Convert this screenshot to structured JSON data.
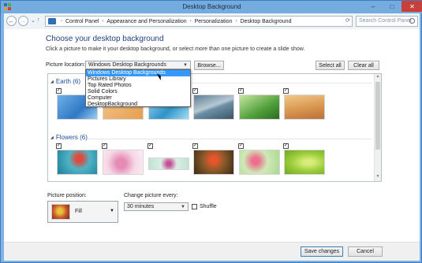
{
  "window": {
    "title": "Desktop Background",
    "controls": {
      "minimize": "–",
      "maximize": "□",
      "close": "✕"
    }
  },
  "nav": {
    "back": "←",
    "forward": "→",
    "recent": "⌄",
    "up": "↑",
    "breadcrumb": [
      "Control Panel",
      "Appearance and Personalization",
      "Personalization",
      "Desktop Background"
    ],
    "separator": "›",
    "refresh": "⟳",
    "search_placeholder": "Search Control Panel"
  },
  "main": {
    "heading": "Choose your desktop background",
    "subheading": "Click a picture to make it your desktop background, or select more than one picture to create a slide show.",
    "picture_location_label": "Picture location:",
    "picture_location_value": "Windows Desktop Backgrounds",
    "browse_label": "Browse...",
    "select_all_label": "Select all",
    "clear_all_label": "Clear all",
    "location_options": [
      "Windows Desktop Backgrounds",
      "Pictures Library",
      "Top Rated Photos",
      "Solid Colors",
      "Computer",
      "DesktopBackground"
    ],
    "groups": [
      {
        "name": "Earth (6)",
        "checked_count": 6
      },
      {
        "name": "Flowers (6)",
        "checked_count": 6
      }
    ],
    "check_mark": "✓",
    "picture_position_label": "Picture position:",
    "picture_position_value": "Fill",
    "change_every_label": "Change picture every:",
    "change_every_value": "30 minutes",
    "shuffle_label": "Shuffle",
    "shuffle_checked": false
  },
  "footer": {
    "save_label": "Save changes",
    "cancel_label": "Cancel"
  },
  "colors": {
    "accent": "#3399ff",
    "title_bar": "#74ace0",
    "close_button": "#c7413a",
    "heading": "#1e3f80"
  }
}
